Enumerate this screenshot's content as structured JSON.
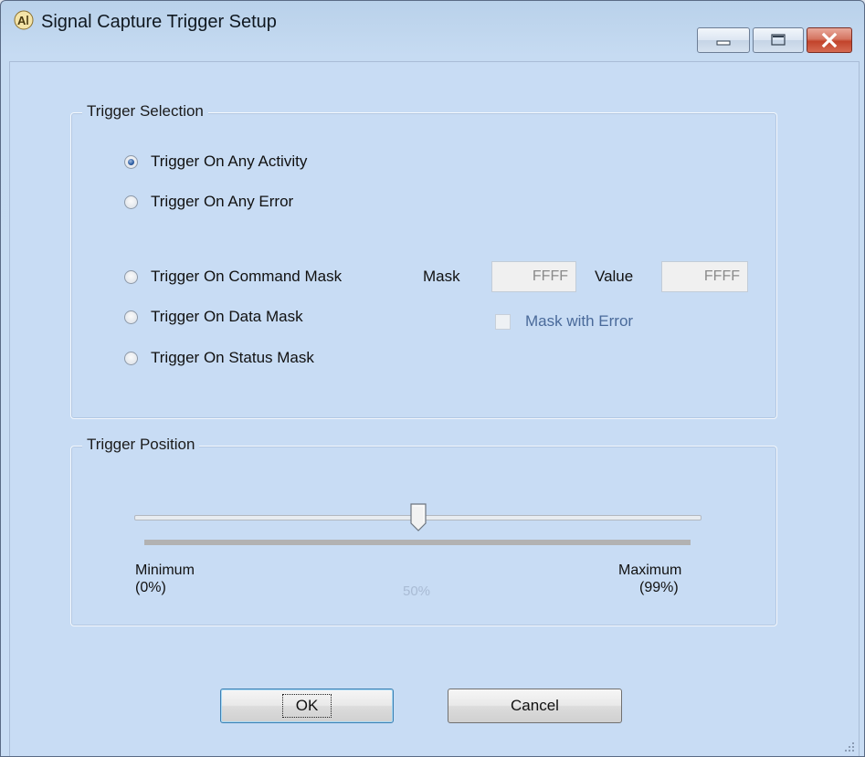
{
  "window": {
    "title": "Signal Capture Trigger Setup"
  },
  "trigger_selection": {
    "title": "Trigger Selection",
    "options": [
      {
        "label": "Trigger On Any Activity",
        "checked": true
      },
      {
        "label": "Trigger On Any Error",
        "checked": false
      },
      {
        "label": "Trigger On Command Mask",
        "checked": false
      },
      {
        "label": "Trigger On Data Mask",
        "checked": false
      },
      {
        "label": "Trigger On Status Mask",
        "checked": false
      }
    ],
    "mask_label": "Mask",
    "mask_value": "FFFF",
    "value_label": "Value",
    "value_value": "FFFF",
    "mask_with_error_label": "Mask with Error",
    "mask_with_error_checked": false
  },
  "trigger_position": {
    "title": "Trigger Position",
    "min_label": "Minimum",
    "min_value": "(0%)",
    "max_label": "Maximum",
    "max_value": "(99%)",
    "current": "50%",
    "current_fraction": 0.5
  },
  "buttons": {
    "ok": "OK",
    "cancel": "Cancel"
  },
  "colors": {
    "window_bg": "#c8dcf4",
    "close_button": "#c2432b"
  }
}
